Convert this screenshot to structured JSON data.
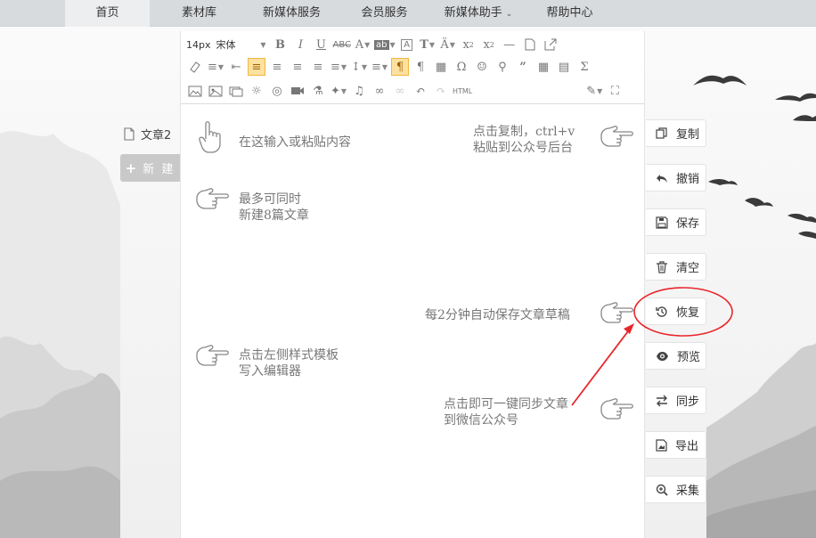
{
  "nav": {
    "items": [
      {
        "label": "首页",
        "active": true
      },
      {
        "label": "素材库",
        "active": false
      },
      {
        "label": "新媒体服务",
        "active": false
      },
      {
        "label": "会员服务",
        "active": false
      },
      {
        "label": "新媒体助手",
        "active": false,
        "dropdown": true
      },
      {
        "label": "帮助中心",
        "active": false
      }
    ]
  },
  "left_panel": {
    "article_tab": "文章2",
    "new_button": "新 建"
  },
  "toolbar": {
    "font_size": "14px",
    "font_family": "宋体",
    "html_label": "HTML"
  },
  "hints": {
    "input": "在这输入或粘贴内容",
    "copy_line1": "点击复制，ctrl+v",
    "copy_line2": "粘贴到公众号后台",
    "max_line1": "最多可同时",
    "max_line2": "新建8篇文章",
    "autosave": "每2分钟自动保存文章草稿",
    "template_line1": "点击左侧样式模板",
    "template_line2": "写入编辑器",
    "sync_line1": "点击即可一键同步文章",
    "sync_line2": "到微信公众号"
  },
  "sidebar": {
    "copy": "复制",
    "undo": "撤销",
    "save": "保存",
    "clear": "清空",
    "restore": "恢复",
    "preview": "预览",
    "sync": "同步",
    "export": "导出",
    "collect": "采集"
  },
  "colors": {
    "nav_bg": "#d8dbde",
    "nav_active_bg": "#eceef0",
    "annotation_red": "#e8262a",
    "selected_tool_bg": "#fde1a0",
    "new_button_bg": "#c9c9c9"
  }
}
